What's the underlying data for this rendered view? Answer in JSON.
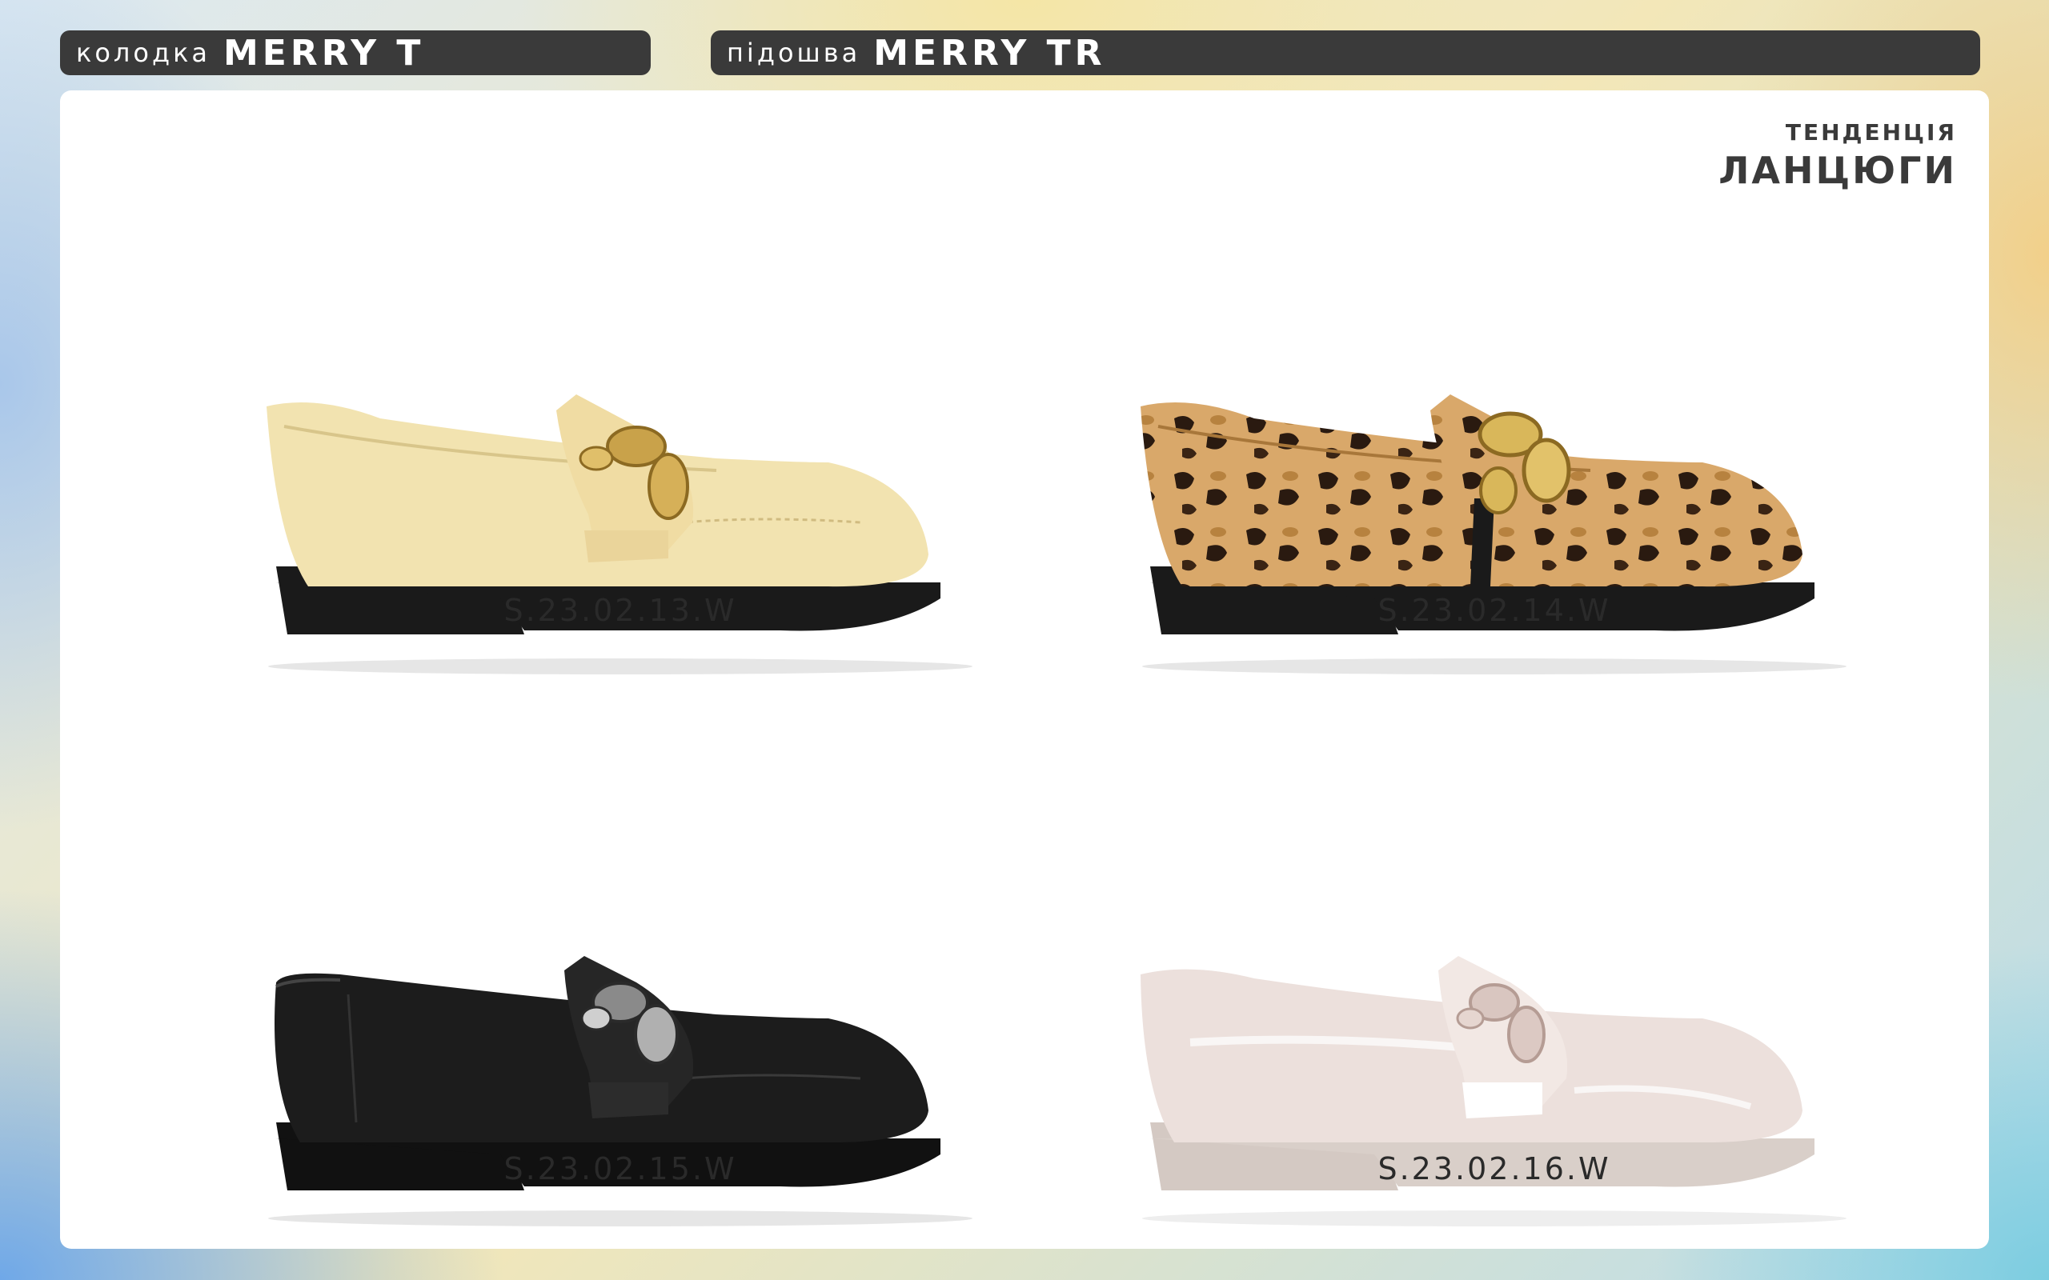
{
  "header": {
    "last": {
      "label": "колодка",
      "value": "MERRY T"
    },
    "sole": {
      "label": "підошва",
      "value": "MERRY TR"
    }
  },
  "trend": {
    "label": "ТЕНДЕНЦІЯ",
    "value": "ЛАНЦЮГИ"
  },
  "products": [
    {
      "sku": "S.23.02.13.W",
      "color": "cream-yellow",
      "upper": "#f2e3b0",
      "sole": "#1a1a1a",
      "chain": "gold-icon"
    },
    {
      "sku": "S.23.02.14.W",
      "color": "leopard-print",
      "upper": "#d9a86a",
      "sole": "#1a1a1a",
      "chain": "gold-icon"
    },
    {
      "sku": "S.23.02.15.W",
      "color": "black",
      "upper": "#1c1c1c",
      "sole": "#111111",
      "chain": "silver-icon"
    },
    {
      "sku": "S.23.02.16.W",
      "color": "powder-pink-patent",
      "upper": "#ece0dc",
      "sole": "#d9cfc9",
      "chain": "powder-icon"
    }
  ]
}
